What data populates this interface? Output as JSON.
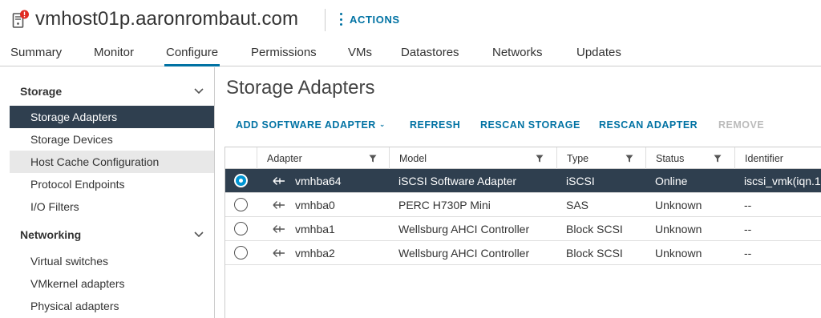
{
  "header": {
    "host_name": "vmhost01p.aaronrombaut.com",
    "actions_label": "ACTIONS",
    "host_icon": "host-server-alert-icon",
    "accent_color": "#0072a3",
    "alert_color": "#e02b22"
  },
  "tabs": [
    {
      "label": "Summary",
      "active": false
    },
    {
      "label": "Monitor",
      "active": false
    },
    {
      "label": "Configure",
      "active": true
    },
    {
      "label": "Permissions",
      "active": false
    },
    {
      "label": "VMs",
      "active": false
    },
    {
      "label": "Datastores",
      "active": false
    },
    {
      "label": "Networks",
      "active": false
    },
    {
      "label": "Updates",
      "active": false
    }
  ],
  "sidebar": {
    "storage": {
      "title": "Storage",
      "items": [
        {
          "label": "Storage Adapters",
          "state": "selected"
        },
        {
          "label": "Storage Devices",
          "state": "normal"
        },
        {
          "label": "Host Cache Configuration",
          "state": "hover"
        },
        {
          "label": "Protocol Endpoints",
          "state": "normal"
        },
        {
          "label": "I/O Filters",
          "state": "normal"
        }
      ]
    },
    "networking": {
      "title": "Networking",
      "items": [
        {
          "label": "Virtual switches",
          "state": "normal"
        },
        {
          "label": "VMkernel adapters",
          "state": "normal"
        },
        {
          "label": "Physical adapters",
          "state": "normal"
        }
      ]
    },
    "selected_bg_color": "#2f3f4f"
  },
  "main": {
    "title": "Storage Adapters",
    "toolbar": {
      "add_software_adapter": "ADD SOFTWARE ADAPTER",
      "refresh": "REFRESH",
      "rescan_storage": "RESCAN STORAGE",
      "rescan_adapter": "RESCAN ADAPTER",
      "remove": "REMOVE",
      "remove_disabled": true
    },
    "table": {
      "columns": [
        "Adapter",
        "Model",
        "Type",
        "Status",
        "Identifier"
      ],
      "rows": [
        {
          "selected": true,
          "adapter": "vmhba64",
          "model": "iSCSI Software Adapter",
          "type": "iSCSI",
          "status": "Online",
          "identifier": "iscsi_vmk(iqn.1"
        },
        {
          "selected": false,
          "adapter": "vmhba0",
          "model": "PERC H730P Mini",
          "type": "SAS",
          "status": "Unknown",
          "identifier": "--"
        },
        {
          "selected": false,
          "adapter": "vmhba1",
          "model": "Wellsburg AHCI Controller",
          "type": "Block SCSI",
          "status": "Unknown",
          "identifier": "--"
        },
        {
          "selected": false,
          "adapter": "vmhba2",
          "model": "Wellsburg AHCI Controller",
          "type": "Block SCSI",
          "status": "Unknown",
          "identifier": "--"
        }
      ]
    }
  }
}
